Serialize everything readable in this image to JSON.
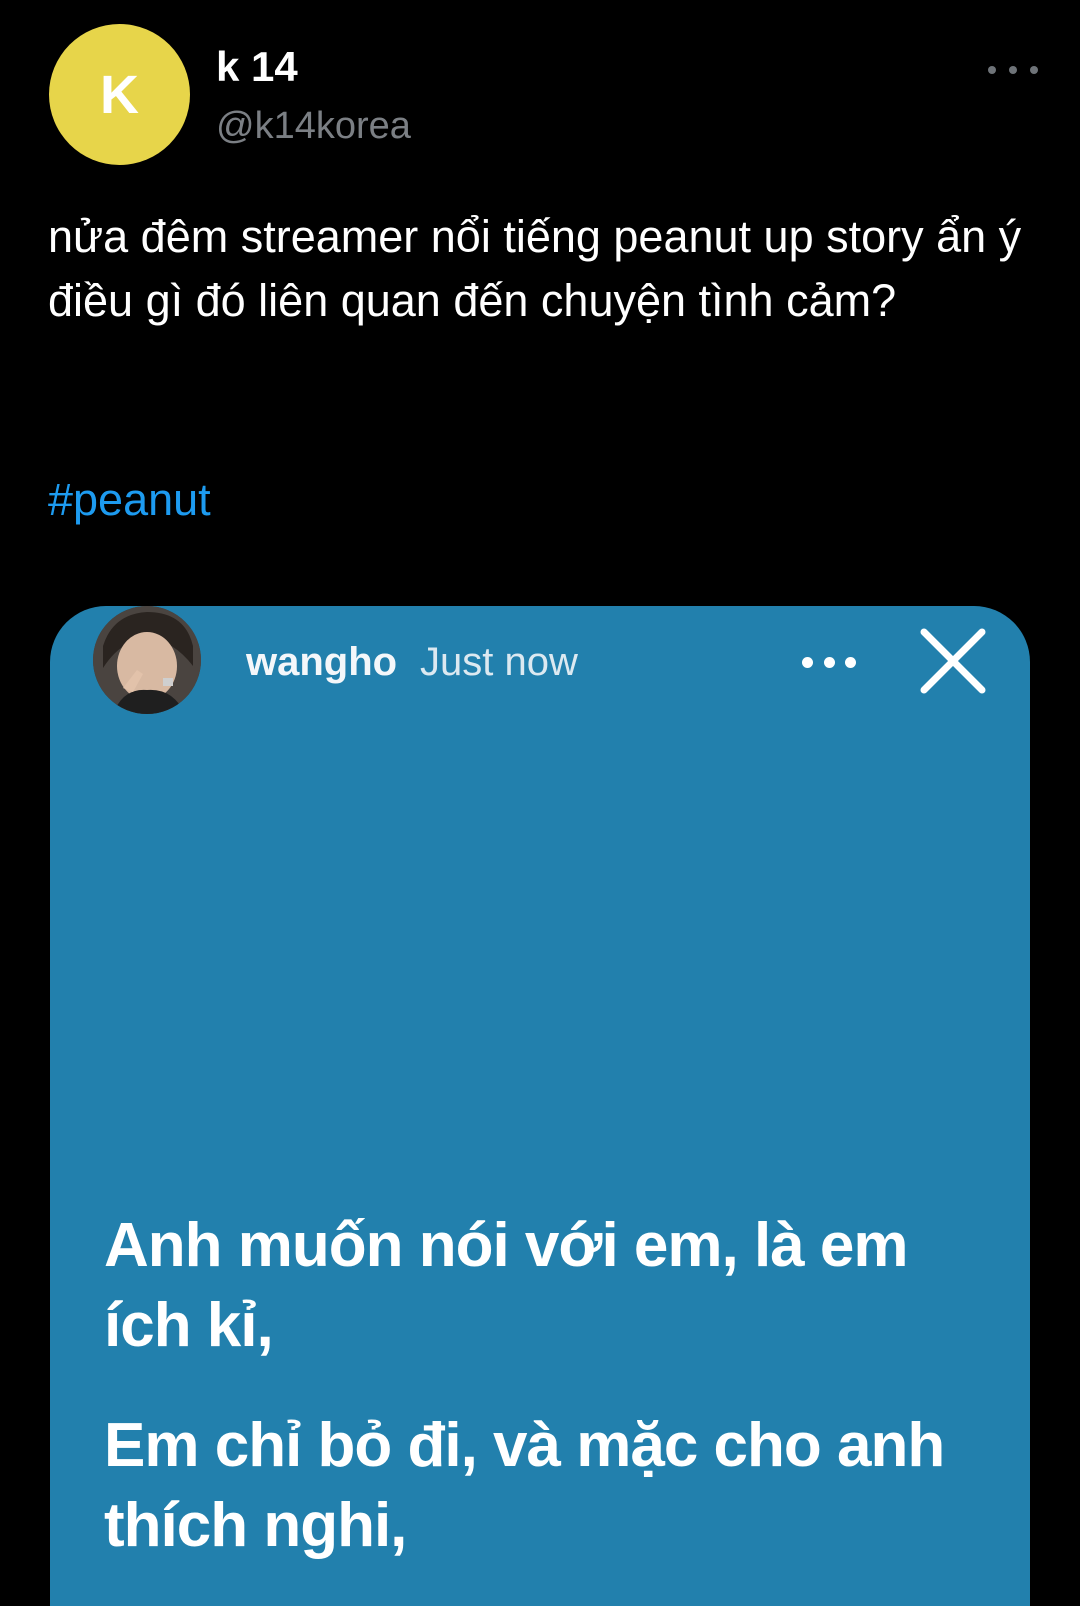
{
  "tweet": {
    "author": {
      "avatar_letter": "K",
      "avatar_color": "#e7d54a",
      "display_name": "k 14",
      "handle": "@k14korea"
    },
    "more_icon": "more-horizontal-icon",
    "text": "nửa đêm streamer nổi tiếng peanut up story ẩn ý điều gì đó liên quan đến chuyện tình cảm?",
    "hashtag": "#peanut",
    "hashtag_color": "#1d9bf0"
  },
  "story": {
    "background_color": "#2280ad",
    "username": "wangho",
    "timestamp": "Just now",
    "more_icon": "more-horizontal-icon",
    "close_icon": "close-icon",
    "lines": [
      "Anh muốn nói với em, là em ích kỉ,",
      "Em chỉ bỏ đi, và mặc cho anh thích nghi,"
    ]
  }
}
